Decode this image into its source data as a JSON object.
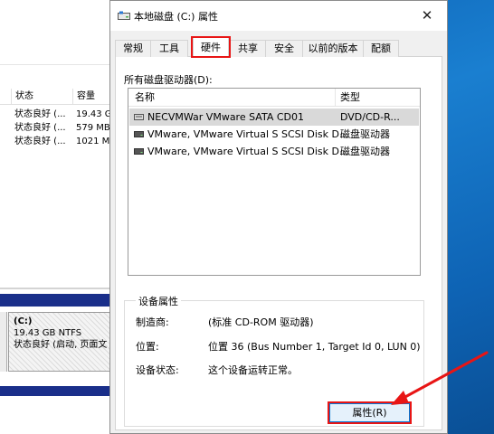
{
  "background_window": {
    "col_status": "状态",
    "col_capacity": "容量",
    "rows": [
      {
        "status": "状态良好 (...",
        "capacity": "19.43 G"
      },
      {
        "status": "状态良好 (...",
        "capacity": "579 MB"
      },
      {
        "status": "状态良好 (...",
        "capacity": "1021 M"
      }
    ],
    "volume": {
      "drive": "(C:)",
      "size": "19.43 GB NTFS",
      "status": "状态良好 (启动, 页面文"
    }
  },
  "dialog": {
    "title": "本地磁盘 (C:) 属性",
    "close_glyph": "✕",
    "tabs": [
      {
        "label": "常规",
        "active": false
      },
      {
        "label": "工具",
        "active": false
      },
      {
        "label": "硬件",
        "active": true
      },
      {
        "label": "共享",
        "active": false
      },
      {
        "label": "安全",
        "active": false
      },
      {
        "label": "以前的版本",
        "active": false
      },
      {
        "label": "配额",
        "active": false
      }
    ],
    "drives_label": "所有磁盘驱动器(D):",
    "list": {
      "col_name": "名称",
      "col_type": "类型",
      "items": [
        {
          "name": "NECVMWar VMware SATA CD01",
          "type": "DVD/CD-R...",
          "selected": true,
          "icon": "cd-drive-icon"
        },
        {
          "name": "VMware, VMware Virtual S SCSI Disk D...",
          "type": "磁盘驱动器",
          "selected": false,
          "icon": "disk-drive-icon"
        },
        {
          "name": "VMware, VMware Virtual S SCSI Disk D...",
          "type": "磁盘驱动器",
          "selected": false,
          "icon": "disk-drive-icon"
        }
      ]
    },
    "device_props": {
      "group_title": "设备属性",
      "manufacturer_label": "制造商:",
      "manufacturer_value": "(标准 CD-ROM 驱动器)",
      "location_label": "位置:",
      "location_value": "位置 36 (Bus Number 1, Target Id 0, LUN 0)",
      "status_label": "设备状态:",
      "status_value": "这个设备运转正常。"
    },
    "properties_button": "属性(R)"
  },
  "colors": {
    "highlight_red": "#e81515",
    "accent_blue": "#0078d7",
    "selected_row": "#d9d9d9"
  }
}
